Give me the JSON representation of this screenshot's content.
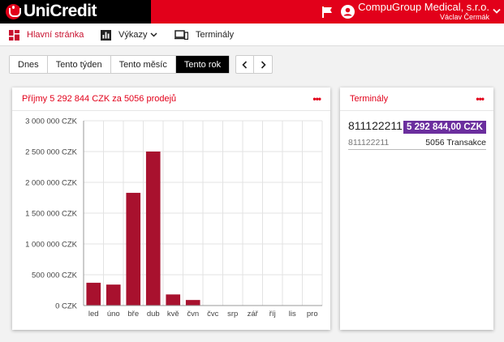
{
  "header": {
    "logo_text": "UniCredit",
    "company_name": "CompuGroup Medical, s.r.o.",
    "user_name": "Václav Čermák",
    "brand_color": "#e2001a"
  },
  "nav": {
    "items": [
      {
        "label": "Hlavní stránka",
        "icon": "dashboard-icon"
      },
      {
        "label": "Výkazy",
        "icon": "bar-chart-icon"
      },
      {
        "label": "Terminály",
        "icon": "devices-icon"
      }
    ]
  },
  "period": {
    "buttons": [
      "Dnes",
      "Tento týden",
      "Tento měsíc",
      "Tento rok"
    ],
    "active": "Tento rok"
  },
  "revenue_card": {
    "title": "Příjmy 5 292 844 CZK za 5056 prodejů",
    "menu_icon": "more-dots-icon"
  },
  "terminals_card": {
    "title": "Terminály",
    "menu_icon": "more-dots-icon",
    "terminal_id": "811122211",
    "amount": "5 292 844,00 CZK",
    "terminal_id_small": "811122211",
    "transactions": "5056 Transakce"
  },
  "chart_data": {
    "type": "bar",
    "categories": [
      "led",
      "úno",
      "bře",
      "dub",
      "kvě",
      "čvn",
      "čvc",
      "srp",
      "zář",
      "říj",
      "lis",
      "pro"
    ],
    "values": [
      370000,
      340000,
      1830000,
      2500000,
      180000,
      90000,
      0,
      0,
      0,
      0,
      0,
      0
    ],
    "ylim": [
      0,
      3000000
    ],
    "yticks": [
      "0 CZK",
      "500 000 CZK",
      "1 000 000 CZK",
      "1 500 000 CZK",
      "2 000 000 CZK",
      "2 500 000 CZK",
      "3 000 000 CZK"
    ],
    "bar_color": "#a8112e",
    "grid": true
  }
}
